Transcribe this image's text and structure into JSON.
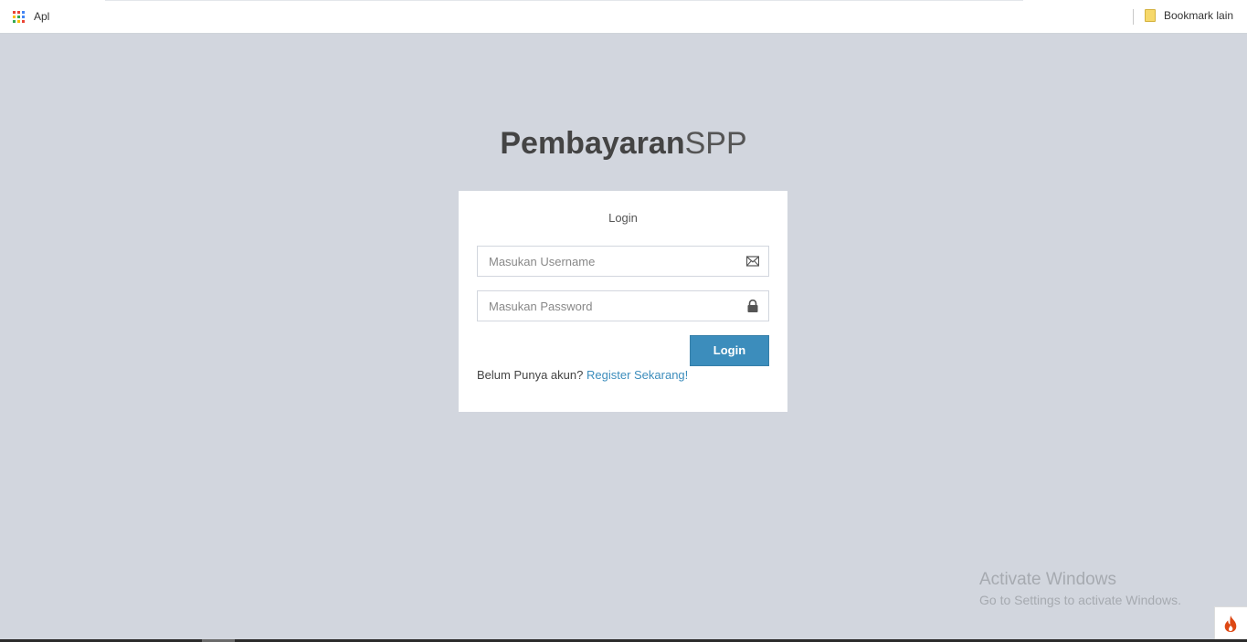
{
  "bookmarks_bar": {
    "apps_label": "Apl",
    "other_bookmarks_label": "Bookmark lain"
  },
  "brand": {
    "bold": "Pembayaran",
    "light": "SPP"
  },
  "login_box": {
    "message": "Login",
    "username_placeholder": "Masukan Username",
    "password_placeholder": "Masukan Password",
    "username_icon": "envelope-icon",
    "password_icon": "lock-icon",
    "login_button": "Login",
    "register_prompt": "Belum Punya akun?",
    "register_link": "Register Sekarang!"
  },
  "watermark": {
    "title": "Activate Windows",
    "subtitle": "Go to Settings to activate Windows."
  },
  "colors": {
    "background": "#d2d6de",
    "primary": "#3c8dbc",
    "box": "#ffffff",
    "codeigniter_flame": "#dd4814"
  }
}
